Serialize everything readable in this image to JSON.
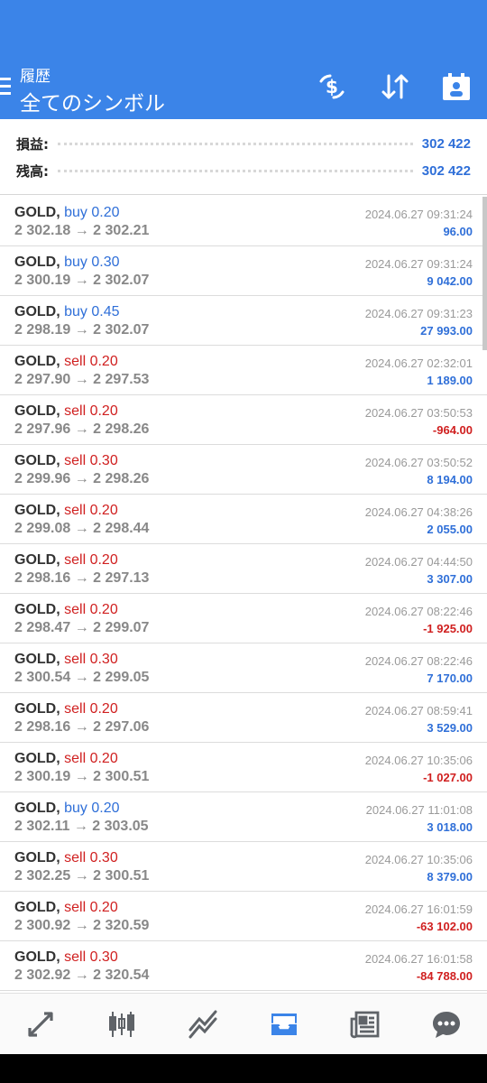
{
  "header": {
    "title_small": "履歴",
    "title_big": "全てのシンボル"
  },
  "summary": {
    "profit_label": "損益:",
    "profit_value": "302 422",
    "balance_label": "残高:",
    "balance_value": "302 422"
  },
  "colors": {
    "accent": "#3b84e8",
    "buy": "#2f6fd8",
    "sell": "#d02020"
  },
  "trades": [
    {
      "symbol": "GOLD,",
      "action": "buy 0.20",
      "side": "buy",
      "prices": "2 302.18 → 2 302.21",
      "date": "2024.06.27 09:31:24",
      "profit": "96.00",
      "sign": "pos"
    },
    {
      "symbol": "GOLD,",
      "action": "buy 0.30",
      "side": "buy",
      "prices": "2 300.19 → 2 302.07",
      "date": "2024.06.27 09:31:24",
      "profit": "9 042.00",
      "sign": "pos"
    },
    {
      "symbol": "GOLD,",
      "action": "buy 0.45",
      "side": "buy",
      "prices": "2 298.19 → 2 302.07",
      "date": "2024.06.27 09:31:23",
      "profit": "27 993.00",
      "sign": "pos"
    },
    {
      "symbol": "GOLD,",
      "action": "sell 0.20",
      "side": "sell",
      "prices": "2 297.90 → 2 297.53",
      "date": "2024.06.27 02:32:01",
      "profit": "1 189.00",
      "sign": "pos"
    },
    {
      "symbol": "GOLD,",
      "action": "sell 0.20",
      "side": "sell",
      "prices": "2 297.96 → 2 298.26",
      "date": "2024.06.27 03:50:53",
      "profit": "-964.00",
      "sign": "neg"
    },
    {
      "symbol": "GOLD,",
      "action": "sell 0.30",
      "side": "sell",
      "prices": "2 299.96 → 2 298.26",
      "date": "2024.06.27 03:50:52",
      "profit": "8 194.00",
      "sign": "pos"
    },
    {
      "symbol": "GOLD,",
      "action": "sell 0.20",
      "side": "sell",
      "prices": "2 299.08 → 2 298.44",
      "date": "2024.06.27 04:38:26",
      "profit": "2 055.00",
      "sign": "pos"
    },
    {
      "symbol": "GOLD,",
      "action": "sell 0.20",
      "side": "sell",
      "prices": "2 298.16 → 2 297.13",
      "date": "2024.06.27 04:44:50",
      "profit": "3 307.00",
      "sign": "pos"
    },
    {
      "symbol": "GOLD,",
      "action": "sell 0.20",
      "side": "sell",
      "prices": "2 298.47 → 2 299.07",
      "date": "2024.06.27 08:22:46",
      "profit": "-1 925.00",
      "sign": "neg"
    },
    {
      "symbol": "GOLD,",
      "action": "sell 0.30",
      "side": "sell",
      "prices": "2 300.54 → 2 299.05",
      "date": "2024.06.27 08:22:46",
      "profit": "7 170.00",
      "sign": "pos"
    },
    {
      "symbol": "GOLD,",
      "action": "sell 0.20",
      "side": "sell",
      "prices": "2 298.16 → 2 297.06",
      "date": "2024.06.27 08:59:41",
      "profit": "3 529.00",
      "sign": "pos"
    },
    {
      "symbol": "GOLD,",
      "action": "sell 0.20",
      "side": "sell",
      "prices": "2 300.19 → 2 300.51",
      "date": "2024.06.27 10:35:06",
      "profit": "-1 027.00",
      "sign": "neg"
    },
    {
      "symbol": "GOLD,",
      "action": "buy 0.20",
      "side": "buy",
      "prices": "2 302.11 → 2 303.05",
      "date": "2024.06.27 11:01:08",
      "profit": "3 018.00",
      "sign": "pos"
    },
    {
      "symbol": "GOLD,",
      "action": "sell 0.30",
      "side": "sell",
      "prices": "2 302.25 → 2 300.51",
      "date": "2024.06.27 10:35:06",
      "profit": "8 379.00",
      "sign": "pos"
    },
    {
      "symbol": "GOLD,",
      "action": "sell 0.20",
      "side": "sell",
      "prices": "2 300.92 → 2 320.59",
      "date": "2024.06.27 16:01:59",
      "profit": "-63 102.00",
      "sign": "neg"
    },
    {
      "symbol": "GOLD,",
      "action": "sell 0.30",
      "side": "sell",
      "prices": "2 302.92 → 2 320.54",
      "date": "2024.06.27 16:01:58",
      "profit": "-84 788.00",
      "sign": "neg"
    }
  ],
  "nav": [
    {
      "icon": "quotes-icon"
    },
    {
      "icon": "chart-icon"
    },
    {
      "icon": "trade-icon"
    },
    {
      "icon": "history-icon",
      "active": true
    },
    {
      "icon": "news-icon"
    },
    {
      "icon": "chat-icon"
    }
  ]
}
